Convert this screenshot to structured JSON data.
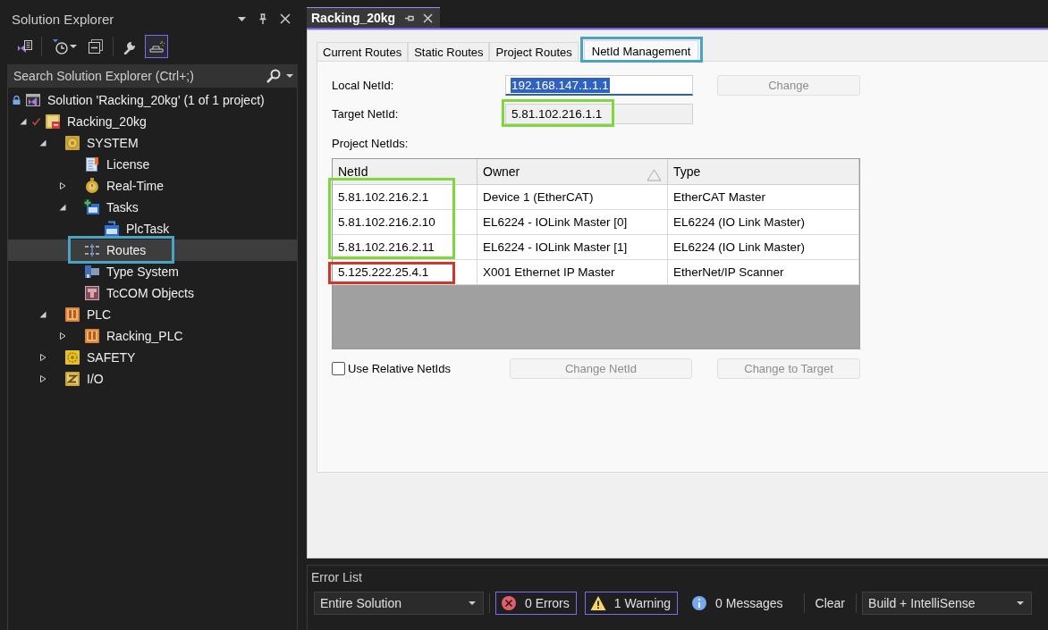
{
  "solution_explorer": {
    "title": "Solution Explorer",
    "toolbar": [
      {
        "selected": false
      },
      {
        "selected": false
      },
      {
        "selected": false
      },
      {
        "selected": false
      },
      {
        "selected": true
      }
    ],
    "search": {
      "placeholder": "Search Solution Explorer (Ctrl+;)"
    },
    "tree": [
      {
        "label": "Solution 'Racking_20kg' (1 of 1 project)",
        "kind": "solution",
        "locked": true,
        "selected": false,
        "children": [
          {
            "label": "Racking_20kg",
            "kind": "project",
            "checked_out": true,
            "expanded": true,
            "selected": false,
            "children": [
              {
                "label": "SYSTEM",
                "kind": "system",
                "expanded": true,
                "selected": false,
                "children": [
                  {
                    "label": "License",
                    "kind": "license",
                    "selected": false
                  },
                  {
                    "label": "Real-Time",
                    "kind": "realtime",
                    "expanded": false,
                    "selected": false
                  },
                  {
                    "label": "Tasks",
                    "kind": "tasks",
                    "expanded": true,
                    "selected": false,
                    "children": [
                      {
                        "label": "PlcTask",
                        "kind": "task",
                        "selected": false
                      }
                    ]
                  },
                  {
                    "label": "Routes",
                    "kind": "routes",
                    "selected": true,
                    "highlight": {
                      "color": "#4ba3c3"
                    }
                  },
                  {
                    "label": "Type System",
                    "kind": "type-system",
                    "selected": false
                  },
                  {
                    "label": "TcCOM Objects",
                    "kind": "tcom",
                    "selected": false
                  }
                ]
              },
              {
                "label": "PLC",
                "kind": "plc",
                "expanded": true,
                "selected": false,
                "children": [
                  {
                    "label": "Racking_PLC",
                    "kind": "plc-project",
                    "expanded": false,
                    "selected": false
                  }
                ]
              },
              {
                "label": "SAFETY",
                "kind": "safety",
                "expanded": false,
                "selected": false
              },
              {
                "label": "I/O",
                "kind": "io",
                "expanded": false,
                "selected": false
              }
            ]
          }
        ]
      }
    ]
  },
  "document_tabs": [
    {
      "label": "Racking_20kg",
      "selected": true
    }
  ],
  "routes_editor": {
    "tabs": [
      {
        "label": "Current Routes",
        "selected": false
      },
      {
        "label": "Static Routes",
        "selected": false
      },
      {
        "label": "Project Routes",
        "selected": false
      },
      {
        "label": "NetId Management",
        "selected": true,
        "highlight": {
          "color": "#4ba3c3"
        }
      }
    ],
    "local_netid": {
      "label": "Local NetId:",
      "value": "192.168.147.1.1.1",
      "focused": true,
      "text_selected": true
    },
    "change_button": {
      "label": "Change",
      "disabled": true
    },
    "target_netid": {
      "label": "Target NetId:",
      "value": "5.81.102.216.1.1",
      "read_only": true,
      "highlight": {
        "color": "#7ed83c"
      }
    },
    "project_netids_label": "Project NetIds:",
    "table": {
      "columns": [
        {
          "label": "NetId"
        },
        {
          "label": "Owner",
          "sort_ascending": true
        },
        {
          "label": "Type"
        }
      ],
      "rows": [
        {
          "cells": [
            "5.81.102.216.2.1",
            "Device 1 (EtherCAT)",
            "EtherCAT Master"
          ],
          "highlight": {
            "color": "#7ed83c"
          }
        },
        {
          "cells": [
            "5.81.102.216.2.10",
            "EL6224 - IOLink Master [0]",
            "EL6224 (IO Link Master)"
          ],
          "highlight": {
            "color": "#7ed83c"
          }
        },
        {
          "cells": [
            "5.81.102.216.2.11",
            "EL6224 - IOLink Master [1]",
            "EL6224 (IO Link Master)"
          ],
          "highlight": {
            "color": "#7ed83c"
          }
        },
        {
          "cells": [
            "5.125.222.25.4.1",
            "X001 Ethernet IP Master",
            "EtherNet/IP Scanner"
          ],
          "highlight": {
            "color": "#d1352b"
          }
        }
      ]
    },
    "use_relative_netids": {
      "label": "Use Relative NetIds",
      "checked": false
    },
    "buttons": [
      {
        "label": "Change NetId",
        "disabled": true
      },
      {
        "label": "Change to Target",
        "disabled": true
      }
    ]
  },
  "error_list": {
    "title": "Error List",
    "scope": {
      "value": "Entire Solution"
    },
    "filters": [
      {
        "kind": "error",
        "label": "0 Errors",
        "selected": true
      },
      {
        "kind": "warning",
        "label": "1 Warning",
        "selected": true
      },
      {
        "kind": "message",
        "label": "0 Messages",
        "selected": false
      }
    ],
    "clear_button": "Clear",
    "source": {
      "value": "Build + IntelliSense"
    }
  }
}
